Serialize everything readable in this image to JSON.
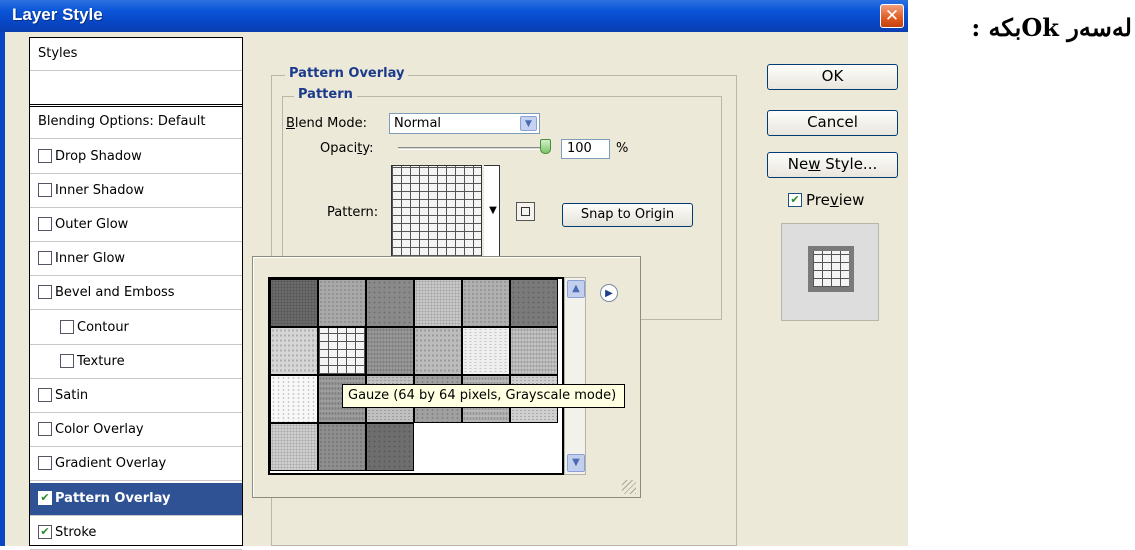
{
  "window": {
    "title": "Layer Style",
    "close_glyph": "✕"
  },
  "styles_list": {
    "header": "Styles",
    "items": [
      {
        "label": "Blending Options: Default",
        "checkbox": false,
        "checked": false
      },
      {
        "label": "Drop Shadow",
        "checkbox": true,
        "checked": false
      },
      {
        "label": "Inner Shadow",
        "checkbox": true,
        "checked": false
      },
      {
        "label": "Outer Glow",
        "checkbox": true,
        "checked": false
      },
      {
        "label": "Inner Glow",
        "checkbox": true,
        "checked": false
      },
      {
        "label": "Bevel and Emboss",
        "checkbox": true,
        "checked": false
      },
      {
        "label": "Contour",
        "checkbox": true,
        "checked": false,
        "indent": true
      },
      {
        "label": "Texture",
        "checkbox": true,
        "checked": false,
        "indent": true
      },
      {
        "label": "Satin",
        "checkbox": true,
        "checked": false
      },
      {
        "label": "Color Overlay",
        "checkbox": true,
        "checked": false
      },
      {
        "label": "Gradient Overlay",
        "checkbox": true,
        "checked": false
      },
      {
        "label": "Pattern Overlay",
        "checkbox": true,
        "checked": true,
        "selected": true
      },
      {
        "label": "Stroke",
        "checkbox": true,
        "checked": true
      }
    ]
  },
  "pattern_overlay": {
    "group_title": "Pattern Overlay",
    "subgroup_title": "Pattern",
    "blend_mode_label": "Blend Mode:",
    "blend_mode_value": "Normal",
    "opacity_label": "Opacity:",
    "opacity_value": "100",
    "opacity_unit": "%",
    "opacity_level": 1.0,
    "pattern_label": "Pattern:",
    "snap_button": "Snap to Origin"
  },
  "picker": {
    "tooltip": "Gauze (64 by 64 pixels, Grayscale mode)",
    "tones": [
      [
        "#6a6a6a",
        "#a8a8a8",
        "#8a8a8a",
        "#c8c8c8",
        "#b0b0b0",
        "#7a7a7a"
      ],
      [
        "#d6d6d6",
        "gauze",
        "#9a9a9a",
        "#bcbcbc",
        "#efefef",
        "#c4c4c4"
      ],
      [
        "#f8f8f8",
        "#9c9c9c",
        "#c0c0c0",
        "#a0a0a0",
        "#b6b6b6",
        "#d0d0d0"
      ],
      [
        "#cfcfcf",
        "#8e8e8e",
        "#6e6e6e"
      ]
    ]
  },
  "buttons": {
    "ok": "OK",
    "cancel": "Cancel",
    "new_style": "New Style..."
  },
  "preview": {
    "label": "Preview",
    "checked": true
  },
  "annotation": {
    "text": "لەسەر Okبکە :"
  },
  "colors": {
    "title_bar": "#0a55d8",
    "selection": "#2f5294",
    "dialog_bg": "#ece9d8",
    "group_label": "#1b3a8c"
  }
}
